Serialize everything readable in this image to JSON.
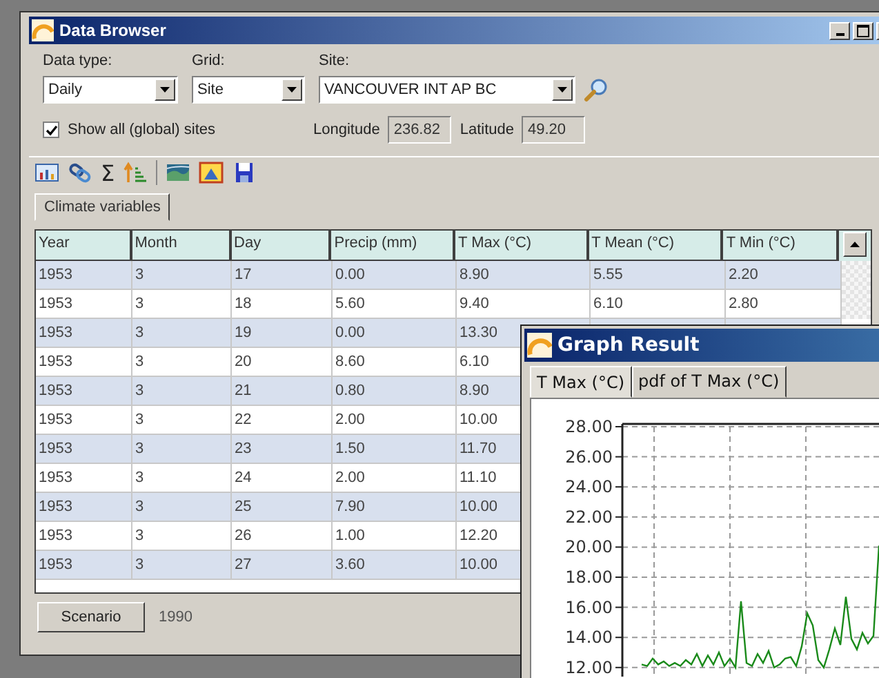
{
  "window": {
    "title": "Data Browser"
  },
  "filters": [
    {
      "label": "Data type:",
      "value": "Daily"
    },
    {
      "label": "Grid:",
      "value": "Site"
    },
    {
      "label": "Site:",
      "value": "VANCOUVER INT AP BC"
    }
  ],
  "show_all_sites": {
    "label": "Show all (global) sites",
    "checked": true
  },
  "coordinates": [
    {
      "label": "Longitude",
      "value": "236.82"
    },
    {
      "label": "Latitude",
      "value": "49.20"
    }
  ],
  "toolbar": [
    {
      "kind": "chart"
    },
    {
      "kind": "link"
    },
    {
      "kind": "glyph",
      "text": "Σ"
    },
    {
      "kind": "sort"
    },
    {
      "kind": "map"
    },
    {
      "kind": "image"
    },
    {
      "kind": "save"
    }
  ],
  "tabs": [
    {
      "label": "Climate variables",
      "selected": true
    }
  ],
  "table": {
    "columns": [
      "Year",
      "Month",
      "Day",
      "Precip (mm)",
      "T Max (°C)",
      "T Mean (°C)",
      "T Min (°C)"
    ],
    "rows": [
      [
        "1953",
        "3",
        "17",
        "0.00",
        "8.90",
        "5.55",
        "2.20"
      ],
      [
        "1953",
        "3",
        "18",
        "5.60",
        "9.40",
        "6.10",
        "2.80"
      ],
      [
        "1953",
        "3",
        "19",
        "0.00",
        "13.30"
      ],
      [
        "1953",
        "3",
        "20",
        "8.60",
        "6.10"
      ],
      [
        "1953",
        "3",
        "21",
        "0.80",
        "8.90"
      ],
      [
        "1953",
        "3",
        "22",
        "2.00",
        "10.00"
      ],
      [
        "1953",
        "3",
        "23",
        "1.50",
        "11.70"
      ],
      [
        "1953",
        "3",
        "24",
        "2.00",
        "11.10"
      ],
      [
        "1953",
        "3",
        "25",
        "7.90",
        "10.00"
      ],
      [
        "1953",
        "3",
        "26",
        "1.00",
        "12.20"
      ],
      [
        "1953",
        "3",
        "27",
        "3.60",
        "10.00"
      ]
    ]
  },
  "scenario": {
    "button": "Scenario",
    "value": "1990"
  },
  "graph_window": {
    "title": "Graph Result",
    "tabs": [
      {
        "label": "T Max (°C)",
        "selected": true
      },
      {
        "label": "pdf of T Max (°C)",
        "selected": false
      }
    ],
    "chart_data": {
      "type": "line",
      "ylim": [
        12,
        28
      ],
      "yticks": [
        {
          "value": 28,
          "label": "28.00"
        },
        {
          "value": 26,
          "label": "26.00"
        },
        {
          "value": 24,
          "label": "24.00"
        },
        {
          "value": 22,
          "label": "22.00"
        },
        {
          "value": 20,
          "label": "20.00"
        },
        {
          "value": 18,
          "label": "18.00"
        },
        {
          "value": 16,
          "label": "16.00"
        },
        {
          "value": 14,
          "label": "14.00"
        },
        {
          "value": 12,
          "label": "12.00"
        }
      ],
      "grid": true,
      "categories": [
        null,
        null,
        null,
        null,
        null,
        null,
        null,
        null,
        null,
        null,
        null,
        null,
        null,
        null,
        null,
        null,
        null,
        null,
        null,
        null,
        null,
        null,
        null,
        null,
        null,
        null,
        null,
        null,
        null,
        null,
        null,
        null,
        null,
        null,
        null,
        null,
        null,
        null,
        null,
        null,
        null,
        null,
        null,
        null
      ],
      "series": [
        {
          "color": "#1a8a1a",
          "values": [
            12.2,
            12.1,
            12.6,
            12.2,
            12.4,
            12.1,
            12.3,
            12.1,
            12.5,
            12.2,
            12.9,
            12.1,
            12.8,
            12.2,
            13.0,
            12.1,
            12.6,
            12.0,
            16.4,
            12.3,
            12.1,
            12.9,
            12.3,
            13.1,
            12.0,
            12.2,
            12.6,
            12.7,
            12.1,
            13.4,
            15.6,
            14.8,
            12.5,
            12.0,
            13.2,
            14.6,
            13.5,
            16.7,
            13.9,
            13.2,
            14.3,
            13.6,
            14.1,
            20.1
          ]
        }
      ]
    }
  }
}
